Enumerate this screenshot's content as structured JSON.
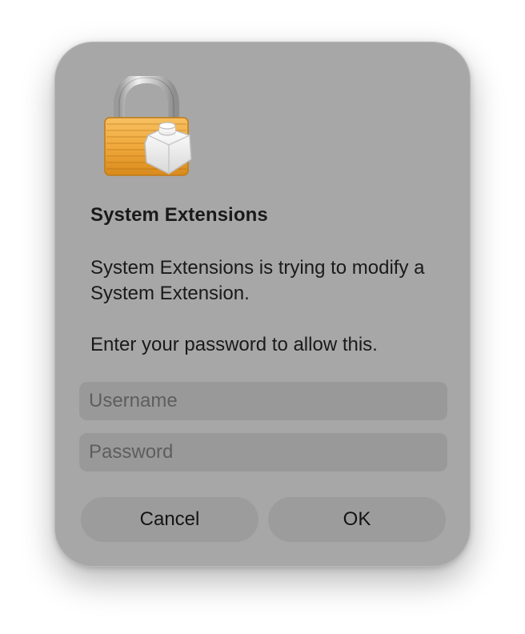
{
  "dialog": {
    "icon": "lock-with-extension-icon",
    "title": "System Extensions",
    "message": "System Extensions is trying to modify a System Extension.",
    "prompt": "Enter your password to allow this.",
    "username_placeholder": "Username",
    "username_value": "",
    "password_placeholder": "Password",
    "password_value": "",
    "cancel_label": "Cancel",
    "ok_label": "OK"
  },
  "colors": {
    "dialog_background": "#a7a7a7",
    "field_background": "#999999",
    "button_background": "#9c9c9c",
    "lock_body": "#f0a93c",
    "text": "#1a1a1a"
  }
}
